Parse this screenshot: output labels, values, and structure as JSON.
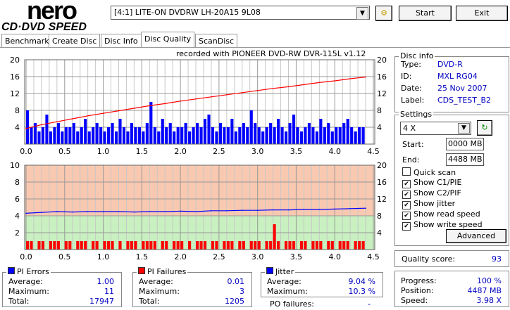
{
  "logo": {
    "line1": "nero",
    "line2": "CD·DVD SPEED"
  },
  "toolbar": {
    "drive": "[4:1]  LITE-ON DVDRW LH-20A15 9L08",
    "start": "Start",
    "exit": "Exit",
    "drive_icon": "settings-gears-icon"
  },
  "tabs": [
    "Benchmark",
    "Create Disc",
    "Disc Info",
    "Disc Quality",
    "ScanDisc"
  ],
  "active_tab": "Disc Quality",
  "chart_header": "recorded with PIONEER DVD-RW  DVR-115L v1.12",
  "chart_data": [
    {
      "type": "bar",
      "xlim": [
        0,
        4.5
      ],
      "ylim_left": [
        0,
        20
      ],
      "ylim_right": [
        0,
        20
      ],
      "left_ticks": [
        "20",
        "16",
        "12",
        "8",
        "4"
      ],
      "right_ticks": [
        "20",
        "16",
        "12",
        "8",
        "4"
      ],
      "x_ticks": [
        "0.0",
        "0.5",
        "1.0",
        "1.5",
        "2.0",
        "2.5",
        "3.0",
        "3.5",
        "4.0",
        "4.5"
      ],
      "series": [
        {
          "kind": "bar",
          "color": "#0000ff",
          "x_step": 0.05,
          "values": [
            8,
            4,
            5,
            3,
            4,
            7,
            3,
            4,
            5,
            3,
            4,
            4,
            5,
            3,
            4,
            6,
            3,
            4,
            5,
            4,
            3,
            4,
            5,
            3,
            6,
            4,
            3,
            5,
            4,
            4,
            3,
            5,
            10,
            4,
            3,
            6,
            4,
            5,
            3,
            4,
            4,
            5,
            3,
            4,
            5,
            4,
            6,
            7,
            4,
            3,
            5,
            4,
            4,
            6,
            3,
            4,
            5,
            4,
            8,
            5,
            4,
            3,
            4,
            5,
            4,
            6,
            4,
            3,
            5,
            7,
            4,
            3,
            4,
            5,
            4,
            3,
            6,
            4,
            5,
            3,
            4,
            4,
            5,
            6,
            4,
            3,
            4,
            4
          ]
        },
        {
          "kind": "line",
          "color": "#ff0000",
          "x_step": 0.2,
          "values": [
            3.7,
            4.6,
            5.3,
            6.0,
            6.7,
            7.3,
            7.9,
            8.5,
            9.1,
            9.6,
            10.2,
            10.7,
            11.2,
            11.7,
            12.2,
            12.7,
            13.2,
            13.6,
            14.1,
            14.6,
            15.0,
            15.5,
            15.9
          ]
        }
      ]
    },
    {
      "type": "bar",
      "xlim": [
        0,
        4.5
      ],
      "ylim_left": [
        0,
        10
      ],
      "ylim_right": [
        0,
        20
      ],
      "left_ticks": [
        "10",
        "8",
        "6",
        "4",
        "2"
      ],
      "right_ticks": [
        "20",
        "16",
        "12",
        "8",
        "4"
      ],
      "x_ticks": [
        "0.0",
        "0.5",
        "1.0",
        "1.5",
        "2.0",
        "2.5",
        "3.0",
        "3.5",
        "4.0",
        "4.5"
      ],
      "band_colors": {
        "upper": "#f8c8b0",
        "lower": "#c8f0c0"
      },
      "band_threshold": 4,
      "series": [
        {
          "kind": "bar",
          "color": "#ff0000",
          "x_step": 0.05,
          "values": [
            1,
            1,
            0,
            1,
            1,
            0,
            1,
            1,
            1,
            0,
            1,
            1,
            0,
            1,
            1,
            1,
            0,
            1,
            1,
            0,
            1,
            1,
            1,
            0,
            1,
            0,
            1,
            1,
            1,
            0,
            1,
            1,
            1,
            1,
            0,
            1,
            1,
            0,
            1,
            1,
            1,
            0,
            1,
            0,
            1,
            1,
            1,
            0,
            1,
            1,
            0,
            1,
            1,
            1,
            0,
            1,
            1,
            0,
            1,
            1,
            1,
            0,
            1,
            1,
            3,
            1,
            0,
            1,
            1,
            1,
            0,
            1,
            1,
            0,
            1,
            1,
            1,
            0,
            1,
            1,
            0,
            1,
            1,
            1,
            0,
            1,
            1,
            1
          ]
        },
        {
          "kind": "line",
          "color": "#0000ff",
          "axis": "right",
          "x_step": 0.2,
          "values": [
            8.6,
            8.8,
            9.0,
            8.9,
            9.0,
            9.0,
            9.0,
            8.9,
            9.0,
            9.0,
            9.1,
            9.0,
            9.2,
            9.2,
            9.3,
            9.3,
            9.4,
            9.4,
            9.5,
            9.5,
            9.6,
            9.7,
            9.8
          ]
        }
      ]
    }
  ],
  "disc_info": {
    "title": "Disc info",
    "rows": [
      {
        "label": "Type:",
        "value": "DVD-R"
      },
      {
        "label": "ID:",
        "value": "MXL RG04"
      },
      {
        "label": "Date:",
        "value": "25 Nov 2007"
      },
      {
        "label": "Label:",
        "value": "CDS_TEST_B2"
      }
    ]
  },
  "settings": {
    "title": "Settings",
    "speed": "4 X",
    "start_label": "Start:",
    "start": "0000 MB",
    "end_label": "End:",
    "end": "4488 MB",
    "checks": [
      {
        "label": "Quick scan",
        "checked": false
      },
      {
        "label": "Show C1/PIE",
        "checked": true
      },
      {
        "label": "Show C2/PIF",
        "checked": true
      },
      {
        "label": "Show jitter",
        "checked": true
      },
      {
        "label": "Show read speed",
        "checked": true
      },
      {
        "label": "Show write speed",
        "checked": true
      }
    ],
    "advanced": "Advanced"
  },
  "quality": {
    "label": "Quality score:",
    "value": "93"
  },
  "progress": {
    "rows": [
      {
        "label": "Progress:",
        "value": "100 %"
      },
      {
        "label": "Position:",
        "value": "4487 MB"
      },
      {
        "label": "Speed:",
        "value": "3.98 X"
      }
    ]
  },
  "pi_errors": {
    "title": "PI Errors",
    "color": "#0000ff",
    "rows": [
      {
        "label": "Average:",
        "value": "1.00"
      },
      {
        "label": "Maximum:",
        "value": "11"
      },
      {
        "label": "Total:",
        "value": "17947"
      }
    ]
  },
  "pi_failures": {
    "title": "PI Failures",
    "color": "#ff0000",
    "rows": [
      {
        "label": "Average:",
        "value": "0.01"
      },
      {
        "label": "Maximum:",
        "value": "3"
      },
      {
        "label": "Total:",
        "value": "1205"
      }
    ]
  },
  "jitter": {
    "title": "Jitter",
    "color": "#0000ff",
    "rows": [
      {
        "label": "Average:",
        "value": "9.04 %"
      },
      {
        "label": "Maximum:",
        "value": "10.3 %"
      }
    ],
    "po_label": "PO failures:",
    "po_value": "-"
  }
}
